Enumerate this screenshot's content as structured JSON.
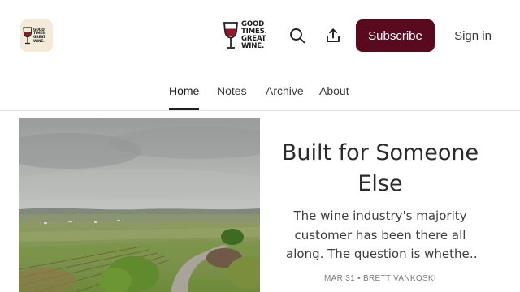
{
  "header": {
    "pub_icon_text": [
      "GOOD",
      "TIMES.",
      "GREAT",
      "WINE."
    ],
    "logo_lines": [
      "GOOD",
      "TIMES.",
      "GREAT",
      "WINE."
    ],
    "subscribe_label": "Subscribe",
    "signin_label": "Sign in"
  },
  "nav": {
    "items": [
      {
        "label": "Home",
        "active": true
      },
      {
        "label": "Notes",
        "active": false
      },
      {
        "label": "Archive",
        "active": false
      },
      {
        "label": "About",
        "active": false
      }
    ]
  },
  "featured": {
    "title": "Built for Someone Else",
    "subtitle": "The wine industry's majority customer has been there all along. The question is whether anyone will finally notice.",
    "date": "MAR 31",
    "separator": "•",
    "author": "BRETT VANKOSKI"
  },
  "colors": {
    "subscribe_bg": "#5a0a1e",
    "wine_red": "#8b1a2b",
    "divider": "#e2e2e2"
  },
  "icons": [
    "wine-glass-icon",
    "search-icon",
    "share-icon"
  ]
}
